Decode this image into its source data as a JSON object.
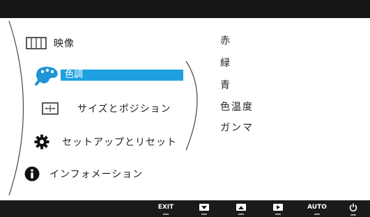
{
  "main_menu": {
    "items": [
      {
        "label": "映像",
        "icon": "picture-icon"
      },
      {
        "label": "色調",
        "icon": "palette-icon",
        "selected": true
      },
      {
        "label": "サイズとポジション",
        "icon": "position-icon"
      },
      {
        "label": "セットアップとリセット",
        "icon": "gear-icon"
      },
      {
        "label": "インフォメーション",
        "icon": "info-icon"
      }
    ]
  },
  "sub_menu": {
    "items": [
      "赤",
      "緑",
      "青",
      "色温度",
      "ガンマ"
    ]
  },
  "buttons": [
    {
      "label": "EXIT",
      "icon": "exit"
    },
    {
      "label": "",
      "icon": "down-arrow-icon"
    },
    {
      "label": "",
      "icon": "up-arrow-icon"
    },
    {
      "label": "",
      "icon": "right-arrow-icon"
    },
    {
      "label": "AUTO",
      "icon": "auto"
    },
    {
      "label": "",
      "icon": "power-icon"
    }
  ],
  "colors": {
    "highlight": "#1fa0e0",
    "bar": "#1a1a1a",
    "background": "#ffffff"
  }
}
